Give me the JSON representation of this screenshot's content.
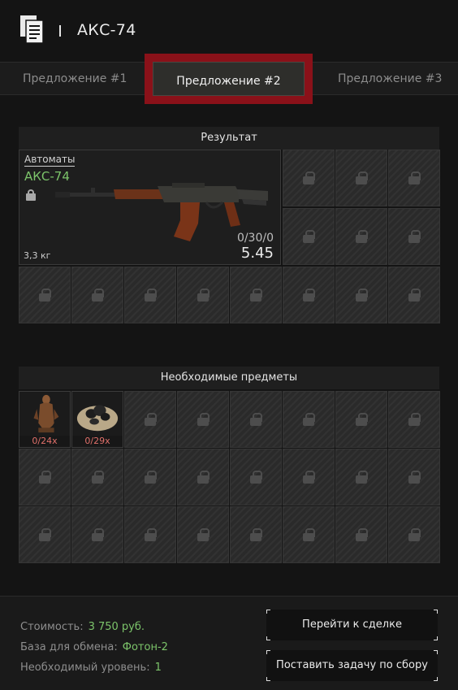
{
  "header": {
    "title": "АКС-74",
    "icon": "document-icon"
  },
  "tabs": [
    {
      "label": "Предложение #1",
      "active": false
    },
    {
      "label": "Предложение #2",
      "active": true
    },
    {
      "label": "Предложение #3",
      "active": false
    }
  ],
  "result": {
    "section_title": "Результат",
    "item": {
      "category": "Автоматы",
      "name": "АКС-74",
      "weight": "3,3 кг",
      "ammo": "0/30/0",
      "caliber": "5.45",
      "locked": true
    },
    "locked_slots": 14
  },
  "required": {
    "section_title": "Необходимые предметы",
    "items": [
      {
        "name": "figurine",
        "count": "0/24x"
      },
      {
        "name": "ore-chunk",
        "count": "0/29x"
      }
    ],
    "locked_slots": 22
  },
  "footer": {
    "cost_label": "Стоимость:",
    "cost_value": "3 750 руб.",
    "base_label": "База для обмена:",
    "base_value": "Фотон-2",
    "level_label": "Необходимый уровень:",
    "level_value": "1",
    "goto_deal_button": "Перейти к сделке",
    "gather_task_button": "Поставить задачу по сбору"
  },
  "colors": {
    "accent_green": "#7cc46a",
    "active_tab_border": "#8a1119",
    "count_red": "#e0706a"
  }
}
